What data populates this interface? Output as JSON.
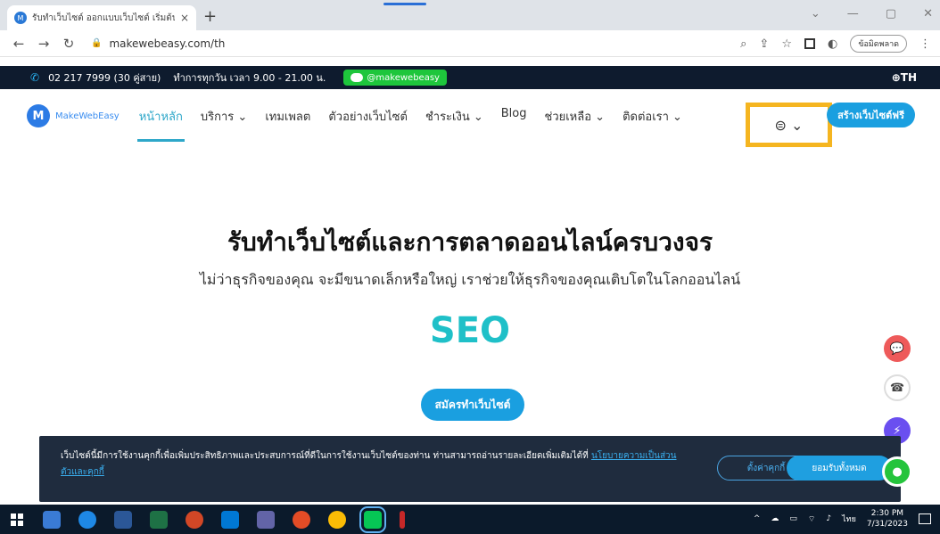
{
  "browser": {
    "tab_title": "รับทำเว็บไซต์ ออกแบบเว็บไซต์ เริ่มต้น",
    "tab_close": "×",
    "new_tab": "+",
    "url": "makewebeasy.com/th",
    "profile_label": "ข้อมิดพลาด",
    "window_controls": [
      "⌄",
      "—",
      "▢",
      "✕"
    ]
  },
  "topstrip": {
    "phone": "02 217 7999 (30 คู่สาย)",
    "hours": "ทำการทุกวัน เวลา 9.00 - 21.00 น.",
    "line_id": "@makewebeasy",
    "language": "⊕TH"
  },
  "nav": {
    "logo_text": "MakeWebEasy",
    "items": [
      {
        "label": "หน้าหลัก",
        "active": true
      },
      {
        "label": "บริการ ⌄"
      },
      {
        "label": "เทมเพลต"
      },
      {
        "label": "ตัวอย่างเว็บไซต์"
      },
      {
        "label": "ชำระเงิน ⌄"
      },
      {
        "label": "Blog"
      },
      {
        "label": "ช่วยเหลือ ⌄"
      },
      {
        "label": "ติดต่อเรา ⌄"
      }
    ],
    "account_label": "⊜ ⌄",
    "cta": "สร้างเว็บไซต์ฟรี"
  },
  "hero": {
    "title": "รับทำเว็บไซต์และการตลาดออนไลน์ครบวงจร",
    "subtitle": "ไม่ว่าธุรกิจของคุณ จะมีขนาดเล็กหรือใหญ่ เราช่วยให้ธุรกิจของคุณเติบโตในโลกออนไลน์",
    "highlight": "SEO",
    "signup_button": "สมัครทำเว็บไซต์"
  },
  "cookie": {
    "text": "เว็บไซต์นี้มีการใช้งานคุกกี้เพื่อเพิ่มประสิทธิภาพและประสบการณ์ที่ดีในการใช้งานเว็บไซต์ของท่าน ท่านสามารถอ่านรายละเอียดเพิ่มเติมได้ที่",
    "link_text": "นโยบายความเป็นส่วนตัวและคุกกี้",
    "settings_button": "ตั้งค่าคุกกี้",
    "accept_button": "ยอมรับทั้งหมด"
  },
  "taskbar": {
    "language": "ไทย",
    "time": "2:30 PM",
    "date": "7/31/2023"
  },
  "colors": {
    "accent": "#1a9fe0",
    "highlight_box": "#f5b520",
    "seo_text": "#1fc0c8",
    "topstrip_bg": "#0e1b2e"
  }
}
